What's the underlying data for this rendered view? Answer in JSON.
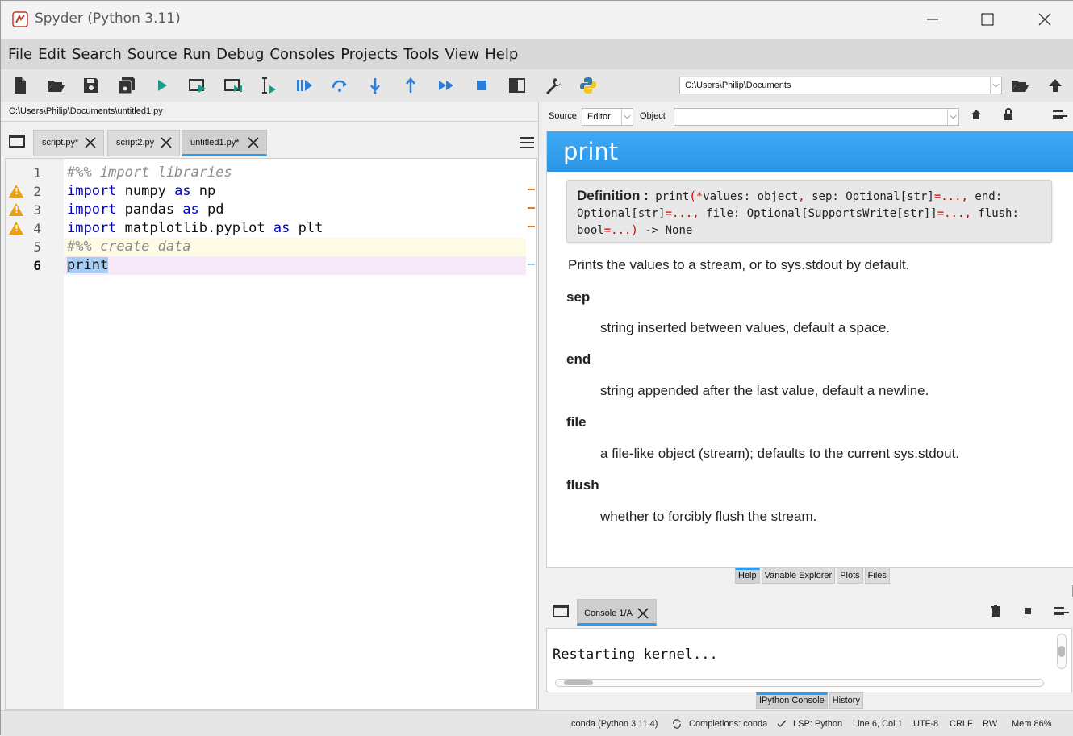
{
  "window": {
    "title": "Spyder (Python 3.11)"
  },
  "menu": {
    "items": [
      "File",
      "Edit",
      "Search",
      "Source",
      "Run",
      "Debug",
      "Consoles",
      "Projects",
      "Tools",
      "View",
      "Help"
    ]
  },
  "toolbar": {
    "working_dir": "C:\\Users\\Philip\\Documents"
  },
  "editor": {
    "file_path": "C:\\Users\\Philip\\Documents\\untitled1.py",
    "tabs": [
      {
        "label": "script.py*"
      },
      {
        "label": "script2.py"
      },
      {
        "label": "untitled1.py*"
      }
    ],
    "line_numbers": [
      "1",
      "2",
      "3",
      "4",
      "5",
      "6"
    ]
  },
  "help": {
    "source_label": "Source",
    "source_value": "Editor",
    "object_label": "Object",
    "object_value": "",
    "title": "print",
    "definition_label": "Definition :",
    "summary": "Prints the values to a stream, or to sys.stdout by default.",
    "params": [
      {
        "name": "sep",
        "desc": "string inserted between values, default a space."
      },
      {
        "name": "end",
        "desc": "string appended after the last value, default a newline."
      },
      {
        "name": "file",
        "desc": "a file-like object (stream); defaults to the current sys.stdout."
      },
      {
        "name": "flush",
        "desc": "whether to forcibly flush the stream."
      }
    ],
    "tabs": [
      "Help",
      "Variable Explorer",
      "Plots",
      "Files"
    ]
  },
  "console": {
    "tab_label": "Console 1/A",
    "output": "Restarting kernel...",
    "tabs": [
      "IPython Console",
      "History"
    ]
  },
  "status": {
    "env": "conda (Python 3.11.4)",
    "completions": "Completions: conda",
    "lsp": "LSP: Python",
    "position": "Line 6, Col 1",
    "encoding": "UTF-8",
    "eol": "CRLF",
    "mode": "RW",
    "memory": "Mem 86%"
  },
  "colors": {
    "accent": "#2b9cf2",
    "keyword": "#0000cc",
    "comment": "#8c8c8c",
    "warning": "#e8a10c",
    "run_icon": "#1a9b8c"
  }
}
